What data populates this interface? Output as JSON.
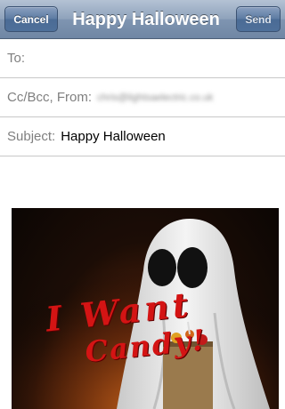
{
  "navbar": {
    "cancel_label": "Cancel",
    "title": "Happy Halloween",
    "send_label": "Send"
  },
  "fields": {
    "to_label": "To:",
    "to_value": "",
    "cc_label": "Cc/Bcc, From:",
    "from_value": "chris@lightsaelectric.co.uk",
    "subject_label": "Subject:",
    "subject_value": "Happy Halloween"
  },
  "attachment": {
    "overlay_text_line1": "I Want",
    "overlay_text_line2": "Candy!"
  },
  "colors": {
    "navbar": "#7f95b1",
    "button": "#4f709a",
    "candy_text": "#d41414"
  }
}
